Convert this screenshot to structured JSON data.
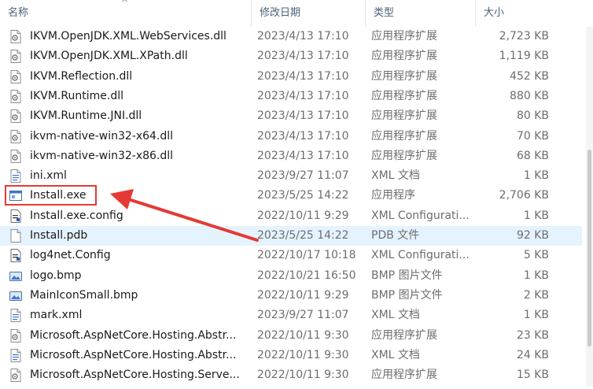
{
  "columns": {
    "name": "名称",
    "date": "修改日期",
    "type": "类型",
    "size": "大小"
  },
  "files": [
    {
      "name": "IKVM.OpenJDK.XML.WebServices.dll",
      "date": "2023/4/13 17:10",
      "type": "应用程序扩展",
      "size": "2,723 KB",
      "icon": "dll-icon"
    },
    {
      "name": "IKVM.OpenJDK.XML.XPath.dll",
      "date": "2023/4/13 17:10",
      "type": "应用程序扩展",
      "size": "1,119 KB",
      "icon": "dll-icon"
    },
    {
      "name": "IKVM.Reflection.dll",
      "date": "2023/4/13 17:10",
      "type": "应用程序扩展",
      "size": "452 KB",
      "icon": "dll-icon"
    },
    {
      "name": "IKVM.Runtime.dll",
      "date": "2023/4/13 17:10",
      "type": "应用程序扩展",
      "size": "880 KB",
      "icon": "dll-icon"
    },
    {
      "name": "IKVM.Runtime.JNI.dll",
      "date": "2023/4/13 17:10",
      "type": "应用程序扩展",
      "size": "80 KB",
      "icon": "dll-icon"
    },
    {
      "name": "ikvm-native-win32-x64.dll",
      "date": "2023/4/13 17:10",
      "type": "应用程序扩展",
      "size": "70 KB",
      "icon": "dll-icon"
    },
    {
      "name": "ikvm-native-win32-x86.dll",
      "date": "2023/4/13 17:10",
      "type": "应用程序扩展",
      "size": "68 KB",
      "icon": "dll-icon"
    },
    {
      "name": "ini.xml",
      "date": "2023/9/27 11:07",
      "type": "XML 文档",
      "size": "1 KB",
      "icon": "xml-icon"
    },
    {
      "name": "Install.exe",
      "date": "2023/5/25 14:22",
      "type": "应用程序",
      "size": "2,706 KB",
      "icon": "exe-icon"
    },
    {
      "name": "Install.exe.config",
      "date": "2022/10/11 9:29",
      "type": "XML Configurati...",
      "size": "1 KB",
      "icon": "config-icon"
    },
    {
      "name": "Install.pdb",
      "date": "2023/5/25 14:22",
      "type": "PDB 文件",
      "size": "92 KB",
      "icon": "blank-file-icon"
    },
    {
      "name": "log4net.Config",
      "date": "2022/10/17 10:18",
      "type": "XML Configurati...",
      "size": "5 KB",
      "icon": "config-icon"
    },
    {
      "name": "logo.bmp",
      "date": "2022/10/21 16:50",
      "type": "BMP 图片文件",
      "size": "1 KB",
      "icon": "bmp-icon"
    },
    {
      "name": "MainIconSmall.bmp",
      "date": "2022/10/11 9:29",
      "type": "BMP 图片文件",
      "size": "2 KB",
      "icon": "bmp-icon"
    },
    {
      "name": "mark.xml",
      "date": "2023/9/27 11:07",
      "type": "XML 文档",
      "size": "1 KB",
      "icon": "xml-icon"
    },
    {
      "name": "Microsoft.AspNetCore.Hosting.Abstr...",
      "date": "2022/10/11 9:30",
      "type": "应用程序扩展",
      "size": "23 KB",
      "icon": "dll-icon"
    },
    {
      "name": "Microsoft.AspNetCore.Hosting.Abstr...",
      "date": "2022/10/11 9:30",
      "type": "XML 文档",
      "size": "24 KB",
      "icon": "xml-icon"
    },
    {
      "name": "Microsoft.AspNetCore.Hosting.Serve...",
      "date": "2022/10/11 9:30",
      "type": "应用程序扩展",
      "size": "15 KB",
      "icon": "dll-icon"
    }
  ],
  "hovered_file": "Install.pdb",
  "annotation": {
    "highlighted_file": "Install.exe",
    "color": "#e53935"
  }
}
